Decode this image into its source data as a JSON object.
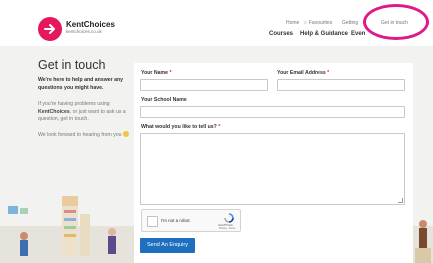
{
  "brand": {
    "name": "KentChoices",
    "url": "kentchoices.co.uk",
    "color": "#e6175c"
  },
  "utility_nav": [
    "Home",
    "Favourites",
    "Getting",
    "Get in touch"
  ],
  "main_nav": [
    "Courses",
    "Help & Guidance",
    "Even"
  ],
  "sidebar": {
    "title": "Get in touch",
    "subtitle": "We're here to help and answer any questions you might have.",
    "para1_pre": "If you're having problems using",
    "para1_brand": "KentChoices",
    "para1_post": ", or just want to ask us a question, get in touch.",
    "para2": "We look forward to hearing from you"
  },
  "form": {
    "name_label": "Your Name",
    "email_label": "Your Email Address",
    "school_label": "Your School Name",
    "message_label": "What would you like to tell us?",
    "required_marker": "*",
    "captcha_label": "I'm not a robot",
    "captcha_brand": "reCAPTCHA",
    "captcha_links": "Privacy - Terms",
    "submit_label": "Send An Enquiry"
  },
  "colors": {
    "accent": "#e0195a",
    "button": "#1f6fbf",
    "annotation": "#e0198a"
  }
}
